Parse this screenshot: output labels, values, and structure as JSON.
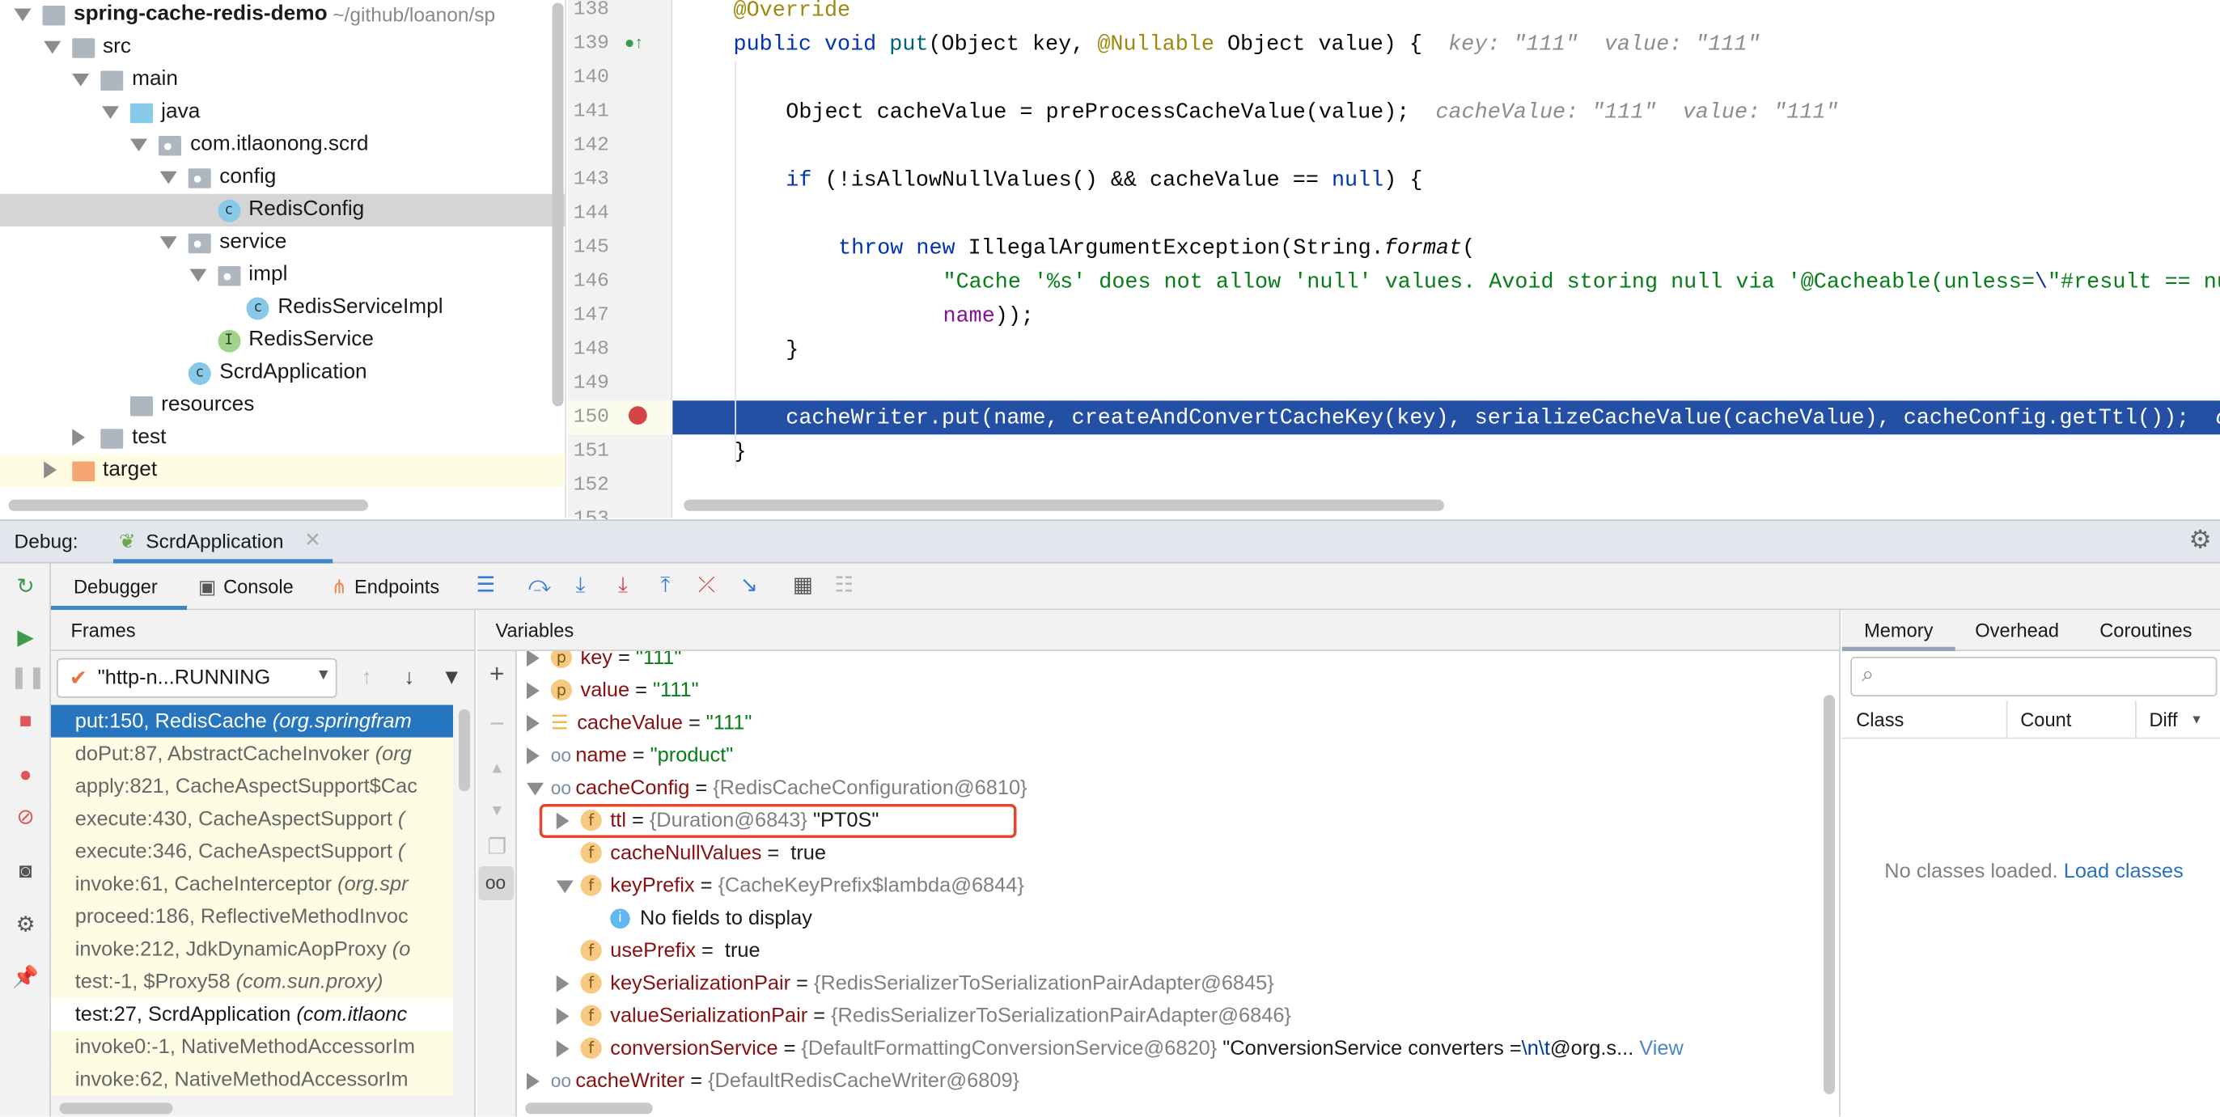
{
  "colors": {
    "accent": "#2675bf",
    "highlight_line": "#2350a5",
    "frame_yellow": "#fdfde4",
    "callout": "#e8432b"
  },
  "project_tree": [
    {
      "label": "spring-cache-redis-demo",
      "hint": "~/github/loanon/sp",
      "level": 0,
      "expand": "open",
      "icon": "module-folder",
      "bold": true
    },
    {
      "label": "src",
      "level": 1,
      "expand": "open",
      "icon": "folder"
    },
    {
      "label": "main",
      "level": 2,
      "expand": "open",
      "icon": "folder"
    },
    {
      "label": "java",
      "level": 3,
      "expand": "open",
      "icon": "source-folder"
    },
    {
      "label": "com.itlaonong.scrd",
      "level": 4,
      "expand": "open",
      "icon": "package"
    },
    {
      "label": "config",
      "level": 5,
      "expand": "open",
      "icon": "package"
    },
    {
      "label": "RedisConfig",
      "level": 6,
      "icon": "class",
      "selected": true
    },
    {
      "label": "service",
      "level": 5,
      "expand": "open",
      "icon": "package"
    },
    {
      "label": "impl",
      "level": 6,
      "expand": "open",
      "icon": "package"
    },
    {
      "label": "RedisServiceImpl",
      "level": 7,
      "icon": "class"
    },
    {
      "label": "RedisService",
      "level": 6,
      "icon": "interface"
    },
    {
      "label": "ScrdApplication",
      "level": 5,
      "icon": "spring-boot-class"
    },
    {
      "label": "resources",
      "level": 3,
      "icon": "resources-folder"
    },
    {
      "label": "test",
      "level": 2,
      "expand": "closed",
      "icon": "folder"
    },
    {
      "label": "target",
      "level": 1,
      "expand": "closed",
      "icon": "excluded-folder",
      "highlight": true
    }
  ],
  "editor": {
    "current_line": "150",
    "lines": [
      {
        "n": "138",
        "indent": 0,
        "tokens": [
          {
            "t": "@Override",
            "k": "ann"
          }
        ]
      },
      {
        "n": "139",
        "indent": 0,
        "gutter": "implements-icon",
        "tokens": [
          {
            "t": "public void ",
            "k": "kw"
          },
          {
            "t": "put",
            "k": "fn"
          },
          {
            "t": "(Object key, "
          },
          {
            "t": "@Nullable",
            "k": "ann"
          },
          {
            "t": " Object value) {  "
          },
          {
            "t": "key: \"111\"  value: \"111\"",
            "k": "hint"
          }
        ]
      },
      {
        "n": "140",
        "indent": 0,
        "tokens": []
      },
      {
        "n": "141",
        "indent": 4,
        "tokens": [
          {
            "t": "Object cacheValue = preProcessCacheValue(value);  "
          },
          {
            "t": "cacheValue: \"111\"  value: \"111\"",
            "k": "hint"
          }
        ]
      },
      {
        "n": "142",
        "indent": 0,
        "tokens": []
      },
      {
        "n": "143",
        "indent": 4,
        "tokens": [
          {
            "t": "if",
            "k": "kw"
          },
          {
            "t": " (!isAllowNullValues() && cacheValue == "
          },
          {
            "t": "null",
            "k": "kw"
          },
          {
            "t": ") {"
          }
        ]
      },
      {
        "n": "144",
        "indent": 0,
        "tokens": []
      },
      {
        "n": "145",
        "indent": 8,
        "tokens": [
          {
            "t": "throw new ",
            "k": "kw"
          },
          {
            "t": "IllegalArgumentException(String."
          },
          {
            "t": "format",
            "k": "it"
          },
          {
            "t": "("
          }
        ]
      },
      {
        "n": "146",
        "indent": 16,
        "tokens": [
          {
            "t": "\"Cache '%s' does not allow 'null' values. Avoid storing null via '@Cacheable(unless=",
            "k": "str"
          },
          {
            "t": "\\",
            "k": "esc"
          },
          {
            "t": "\"#result == null",
            "k": "str"
          }
        ]
      },
      {
        "n": "147",
        "indent": 16,
        "tokens": [
          {
            "t": "name",
            "k": "fld"
          },
          {
            "t": "));"
          }
        ]
      },
      {
        "n": "148",
        "indent": 4,
        "tokens": [
          {
            "t": "}"
          }
        ]
      },
      {
        "n": "149",
        "indent": 0,
        "tokens": []
      },
      {
        "n": "150",
        "indent": 4,
        "gutter": "breakpoint-icon",
        "tokens": [
          {
            "t": "cacheWriter.put(name, createAndConvertCacheKey(key), serializeCacheValue(cacheValue), cacheConfig.getTtl());  "
          },
          {
            "t": "c",
            "k": "hint"
          }
        ]
      },
      {
        "n": "151",
        "indent": 0,
        "tokens": [
          {
            "t": "}"
          }
        ]
      },
      {
        "n": "152",
        "indent": 0,
        "tokens": []
      },
      {
        "n": "153",
        "indent": 0,
        "tokens": []
      }
    ]
  },
  "debug": {
    "label": "Debug:",
    "session_tab": "ScrdApplication",
    "tabs": [
      "Debugger",
      "Console",
      "Endpoints"
    ],
    "frames_title": "Frames",
    "variables_title": "Variables",
    "thread": "\"http-n...RUNNING",
    "frames": [
      {
        "method": "put:150, RedisCache",
        "pkg": "(org.springfram",
        "style": "sel"
      },
      {
        "method": "doPut:87, AbstractCacheInvoker",
        "pkg": "(org",
        "style": "yellow"
      },
      {
        "method": "apply:821, CacheAspectSupport$Cac",
        "pkg": "",
        "style": "yellow"
      },
      {
        "method": "execute:430, CacheAspectSupport",
        "pkg": "(",
        "style": "yellow"
      },
      {
        "method": "execute:346, CacheAspectSupport",
        "pkg": "(",
        "style": "yellow"
      },
      {
        "method": "invoke:61, CacheInterceptor",
        "pkg": "(org.spr",
        "style": "yellow"
      },
      {
        "method": "proceed:186, ReflectiveMethodInvoc",
        "pkg": "",
        "style": "yellow"
      },
      {
        "method": "invoke:212, JdkDynamicAopProxy",
        "pkg": "(o",
        "style": "yellow"
      },
      {
        "method": "test:-1, $Proxy58",
        "pkg": "(com.sun.proxy)",
        "style": "yellow"
      },
      {
        "method": "test:27, ScrdApplication",
        "pkg": "(com.itlaonc",
        "style": "white"
      },
      {
        "method": "invoke0:-1, NativeMethodAccessorIm",
        "pkg": "",
        "style": "yellow"
      },
      {
        "method": "invoke:62, NativeMethodAccessorIm",
        "pkg": "",
        "style": "yellow"
      }
    ],
    "variables": [
      {
        "level": 0,
        "expand": "closed",
        "icon": "p",
        "name": "key",
        "str": "\"111\""
      },
      {
        "level": 0,
        "expand": "closed",
        "icon": "p",
        "name": "value",
        "str": "\"111\""
      },
      {
        "level": 0,
        "expand": "closed",
        "icon": "list",
        "name": "cacheValue",
        "str": "\"111\""
      },
      {
        "level": 0,
        "expand": "closed",
        "icon": "watch",
        "name": "name",
        "str": "\"product\""
      },
      {
        "level": 0,
        "expand": "open",
        "icon": "watch",
        "name": "cacheConfig",
        "type": "{RedisCacheConfiguration@6810}"
      },
      {
        "level": 1,
        "expand": "closed",
        "icon": "f",
        "name": "ttl",
        "type": "{Duration@6843}",
        "plain": "\"PT0S\"",
        "callout": true
      },
      {
        "level": 1,
        "icon": "f",
        "name": "cacheNullValues",
        "plain": "true"
      },
      {
        "level": 1,
        "expand": "open",
        "icon": "f",
        "name": "keyPrefix",
        "type": "{CacheKeyPrefix$lambda@6844}"
      },
      {
        "level": 2,
        "icon": "info",
        "message": "No fields to display"
      },
      {
        "level": 1,
        "icon": "f",
        "name": "usePrefix",
        "plain": "true"
      },
      {
        "level": 1,
        "expand": "closed",
        "icon": "f",
        "name": "keySerializationPair",
        "type": "{RedisSerializerToSerializationPairAdapter@6845}"
      },
      {
        "level": 1,
        "expand": "closed",
        "icon": "f",
        "name": "valueSerializationPair",
        "type": "{RedisSerializerToSerializationPairAdapter@6846}"
      },
      {
        "level": 1,
        "expand": "closed",
        "icon": "f",
        "name": "conversionService",
        "type": "{DefaultFormattingConversionService@6820}",
        "plain": "\"ConversionService converters =",
        "esc": "\\n\\t",
        "tail": "@org.s...",
        "link": "View"
      },
      {
        "level": 0,
        "expand": "closed",
        "icon": "watch",
        "name": "cacheWriter",
        "type": "{DefaultRedisCacheWriter@6809}"
      }
    ]
  },
  "memory": {
    "tabs": [
      "Memory",
      "Overhead",
      "Coroutines"
    ],
    "search_placeholder": "",
    "columns": [
      "Class",
      "Count",
      "Diff"
    ],
    "empty_text": "No classes loaded.",
    "load_link": "Load classes"
  }
}
